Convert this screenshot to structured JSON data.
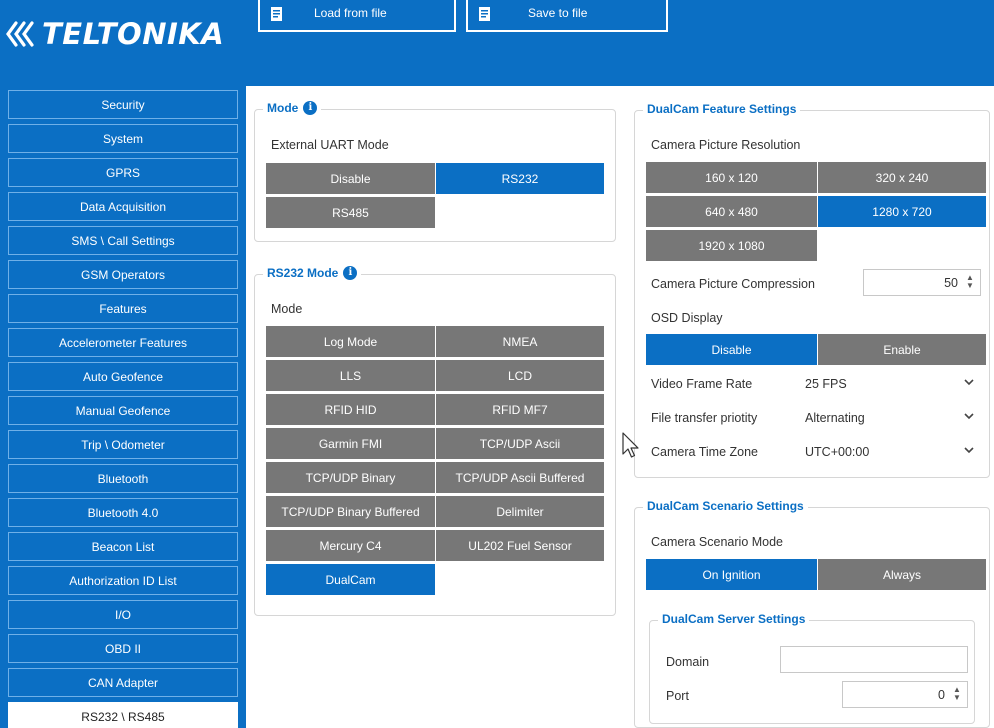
{
  "header": {
    "logo_text": "TELTONIKA",
    "load_label": "Load from file",
    "save_label": "Save to file"
  },
  "sidebar": {
    "items": [
      {
        "label": "Security",
        "active": false
      },
      {
        "label": "System",
        "active": false
      },
      {
        "label": "GPRS",
        "active": false
      },
      {
        "label": "Data Acquisition",
        "active": false
      },
      {
        "label": "SMS \\ Call Settings",
        "active": false
      },
      {
        "label": "GSM Operators",
        "active": false
      },
      {
        "label": "Features",
        "active": false
      },
      {
        "label": "Accelerometer Features",
        "active": false
      },
      {
        "label": "Auto Geofence",
        "active": false
      },
      {
        "label": "Manual Geofence",
        "active": false
      },
      {
        "label": "Trip \\ Odometer",
        "active": false
      },
      {
        "label": "Bluetooth",
        "active": false
      },
      {
        "label": "Bluetooth 4.0",
        "active": false
      },
      {
        "label": "Beacon List",
        "active": false
      },
      {
        "label": "Authorization ID List",
        "active": false
      },
      {
        "label": "I/O",
        "active": false
      },
      {
        "label": "OBD II",
        "active": false
      },
      {
        "label": "CAN Adapter",
        "active": false
      },
      {
        "label": "RS232 \\ RS485",
        "active": true
      }
    ]
  },
  "mode_group": {
    "title": "Mode",
    "uart_label": "External UART Mode",
    "options": [
      {
        "label": "Disable",
        "selected": false
      },
      {
        "label": "RS232",
        "selected": true
      },
      {
        "label": "RS485",
        "selected": false
      }
    ]
  },
  "rs232_group": {
    "title": "RS232 Mode",
    "mode_label": "Mode",
    "options": [
      {
        "label": "Log Mode",
        "selected": false
      },
      {
        "label": "NMEA",
        "selected": false
      },
      {
        "label": "LLS",
        "selected": false
      },
      {
        "label": "LCD",
        "selected": false
      },
      {
        "label": "RFID HID",
        "selected": false
      },
      {
        "label": "RFID MF7",
        "selected": false
      },
      {
        "label": "Garmin FMI",
        "selected": false
      },
      {
        "label": "TCP/UDP Ascii",
        "selected": false
      },
      {
        "label": "TCP/UDP Binary",
        "selected": false
      },
      {
        "label": "TCP/UDP Ascii Buffered",
        "selected": false
      },
      {
        "label": "TCP/UDP Binary Buffered",
        "selected": false
      },
      {
        "label": "Delimiter",
        "selected": false
      },
      {
        "label": "Mercury C4",
        "selected": false
      },
      {
        "label": "UL202 Fuel Sensor",
        "selected": false
      },
      {
        "label": "DualCam",
        "selected": true
      }
    ]
  },
  "dualcam_feature": {
    "title": "DualCam Feature Settings",
    "resolution_label": "Camera Picture Resolution",
    "resolutions": [
      {
        "label": "160 x 120",
        "selected": false
      },
      {
        "label": "320 x 240",
        "selected": false
      },
      {
        "label": "640 x 480",
        "selected": false
      },
      {
        "label": "1280 x 720",
        "selected": true
      },
      {
        "label": "1920 x 1080",
        "selected": false
      }
    ],
    "compression_label": "Camera Picture Compression",
    "compression_value": "50",
    "osd_label": "OSD Display",
    "osd_options": [
      {
        "label": "Disable",
        "selected": true
      },
      {
        "label": "Enable",
        "selected": false
      }
    ],
    "frame_rate_label": "Video Frame Rate",
    "frame_rate_value": "25 FPS",
    "transfer_label": "File transfer priotity",
    "transfer_value": "Alternating",
    "timezone_label": "Camera Time Zone",
    "timezone_value": "UTC+00:00"
  },
  "dualcam_scenario": {
    "title": "DualCam Scenario Settings",
    "mode_label": "Camera Scenario Mode",
    "options": [
      {
        "label": "On Ignition",
        "selected": true
      },
      {
        "label": "Always",
        "selected": false
      }
    ]
  },
  "dualcam_server": {
    "title": "DualCam Server Settings",
    "domain_label": "Domain",
    "domain_value": "",
    "port_label": "Port",
    "port_value": "0"
  },
  "colors": {
    "brand_blue": "#0b6fc4",
    "unselected_gray": "#777777",
    "group_border": "#d6d6d6"
  }
}
